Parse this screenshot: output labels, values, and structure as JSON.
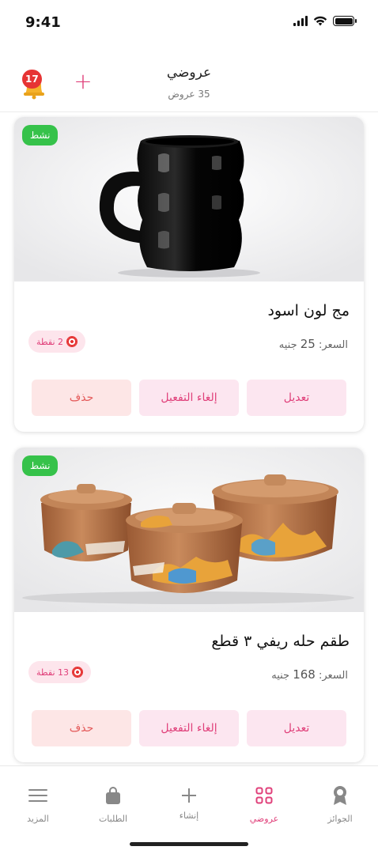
{
  "status_bar": {
    "time": "9:41"
  },
  "header": {
    "title": "عروضي",
    "subtitle": "35 عروض",
    "notifications_count": "17",
    "add_label": "+"
  },
  "offers": [
    {
      "status": "نشط",
      "title": "مج لون اسود",
      "price_label": "السعر:",
      "price_value": "25",
      "currency": "جنيه",
      "points": "2 نقطة",
      "edit_label": "تعديل",
      "deactivate_label": "إلغاء التفعيل",
      "delete_label": "حذف"
    },
    {
      "status": "نشط",
      "title": "طقم حله ريفي ٣ قطع",
      "price_label": "السعر:",
      "price_value": "168",
      "currency": "جنيه",
      "points": "13 نقطة",
      "edit_label": "تعديل",
      "deactivate_label": "إلغاء التفعيل",
      "delete_label": "حذف"
    }
  ],
  "bottom_nav": {
    "items": [
      {
        "label": "المزيد",
        "icon": "menu-icon"
      },
      {
        "label": "الطلبات",
        "icon": "shopping-bag-icon"
      },
      {
        "label": "إنشاء",
        "icon": "plus-icon"
      },
      {
        "label": "عروضي",
        "icon": "grid-icon",
        "active": true
      },
      {
        "label": "الجوائز",
        "icon": "award-icon"
      }
    ]
  },
  "colors": {
    "accent": "#e0407a",
    "active_badge": "#36c24a",
    "delete": "#e45a5a",
    "notification_badge": "#e63434"
  }
}
